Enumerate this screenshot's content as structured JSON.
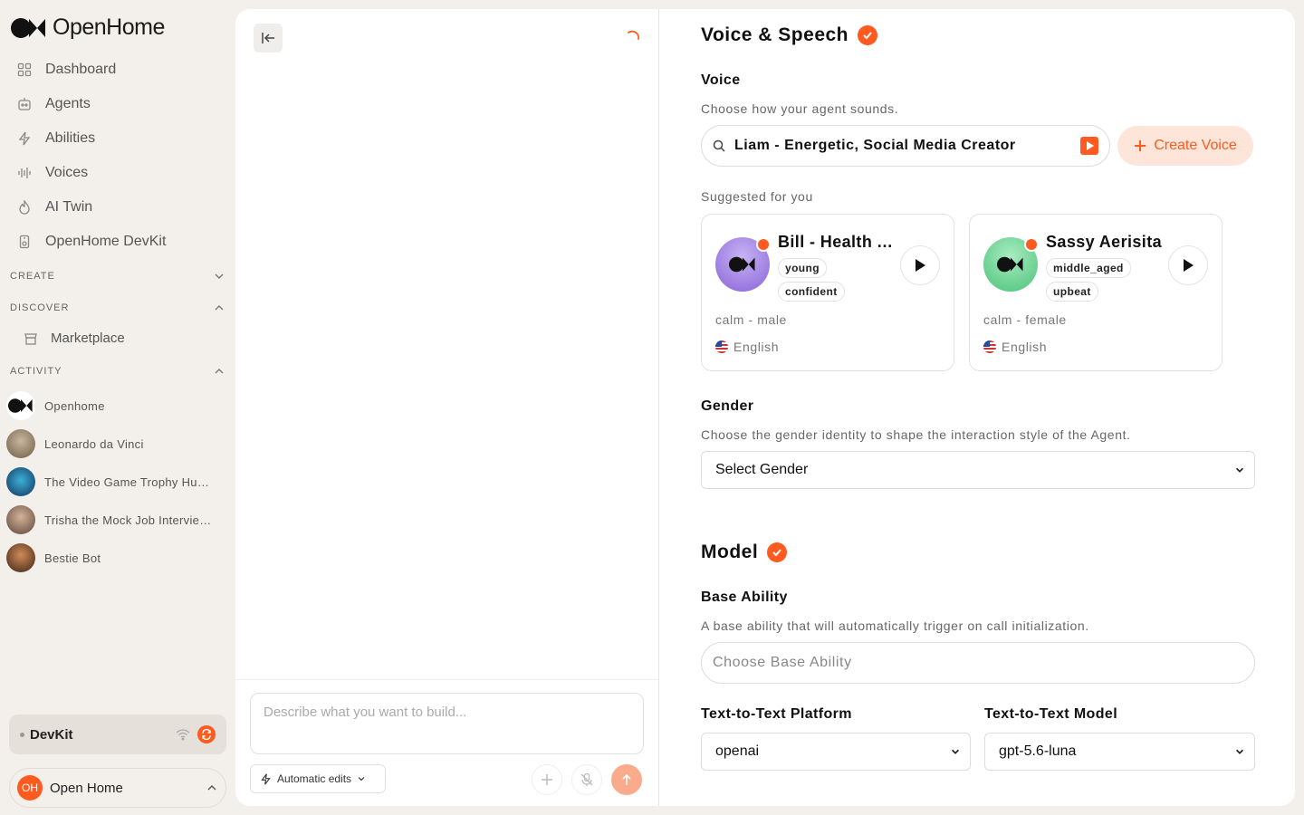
{
  "sidebar": {
    "brand": "OpenHome",
    "nav": [
      {
        "label": "Dashboard",
        "icon": "grid-icon"
      },
      {
        "label": "Agents",
        "icon": "robot-icon"
      },
      {
        "label": "Abilities",
        "icon": "bolt-icon"
      },
      {
        "label": "Voices",
        "icon": "waveform-icon"
      },
      {
        "label": "AI Twin",
        "icon": "flame-icon"
      },
      {
        "label": "OpenHome DevKit",
        "icon": "device-icon"
      }
    ],
    "sections": {
      "create": "CREATE",
      "discover": "DISCOVER",
      "activity": "ACTIVITY"
    },
    "marketplace": "Marketplace",
    "activity": [
      {
        "label": "Openhome"
      },
      {
        "label": "Leonardo da Vinci"
      },
      {
        "label": "The Video Game Trophy Hunter"
      },
      {
        "label": "Trisha the Mock Job Interviewer"
      },
      {
        "label": "Bestie Bot"
      }
    ],
    "devkit_label": "DevKit",
    "user": {
      "initials": "OH",
      "name": "Open Home"
    }
  },
  "builder": {
    "prompt_placeholder": "Describe what you want to build...",
    "auto_edits_label": "Automatic edits"
  },
  "voice_section": {
    "title": "Voice & Speech",
    "voice_label": "Voice",
    "voice_help": "Choose how your agent sounds.",
    "voice_value": "Liam - Energetic, Social Media Creator",
    "create_voice_label": "Create Voice",
    "suggested_label": "Suggested for you",
    "cards": [
      {
        "name": "Bill - Health Advisor",
        "tags": [
          "young",
          "confident"
        ],
        "desc": "calm - male",
        "lang": "English",
        "color": "#9b7be0"
      },
      {
        "name": "Sassy Aerisita",
        "tags": [
          "middle_aged",
          "upbeat"
        ],
        "desc": "calm - female",
        "lang": "English",
        "color": "#5fd08b"
      }
    ],
    "gender_label": "Gender",
    "gender_help": "Choose the gender identity to shape the interaction style of the Agent.",
    "gender_value": "Select Gender"
  },
  "model_section": {
    "title": "Model",
    "base_label": "Base Ability",
    "base_help": "A base ability that will automatically trigger on call initialization.",
    "base_placeholder": "Choose Base Ability",
    "platform_label": "Text-to-Text Platform",
    "platform_value": "openai",
    "model_label": "Text-to-Text Model",
    "model_value": "gpt-5.6-luna"
  },
  "colors": {
    "accent": "#ff5a1f",
    "background": "#f3efea"
  }
}
